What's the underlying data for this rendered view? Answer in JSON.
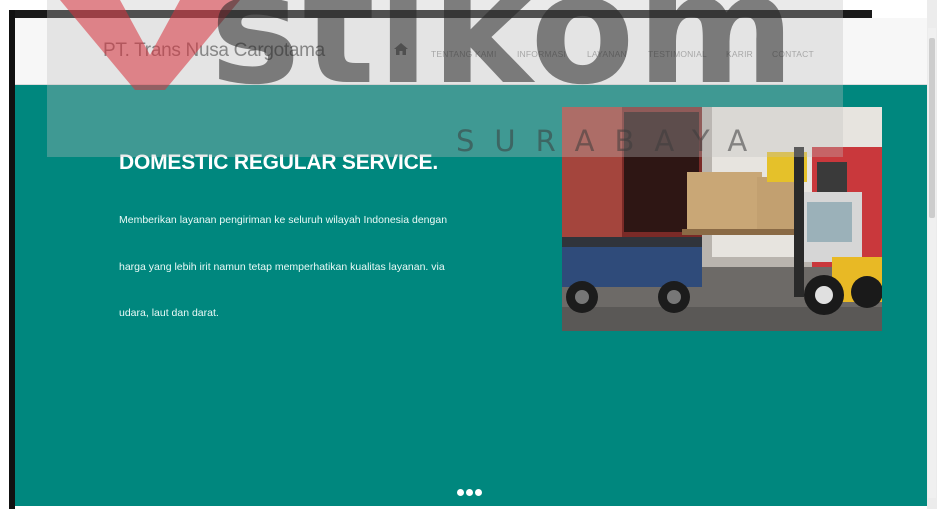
{
  "navbar": {
    "brand": "PT. Trans Nusa Cargotama",
    "home_icon": "home-icon",
    "items": [
      {
        "label": "TENTANG KAMI"
      },
      {
        "label": "INFORMASI"
      },
      {
        "label": "LAYANAN"
      },
      {
        "label": "TESTIMONIAL"
      },
      {
        "label": "KARIR"
      },
      {
        "label": "CONTACT"
      }
    ]
  },
  "hero": {
    "title": "DOMESTIC REGULAR SERVICE.",
    "lines": [
      "Memberikan layanan pengiriman ke seluruh wilayah Indonesia dengan",
      "harga yang lebih irit namun tetap memperhatikan kualitas layanan. via",
      "udara, laut dan darat."
    ],
    "image": "cargo-forklift-photo",
    "slides": 3
  },
  "watermark": {
    "word": "stikom",
    "sub": "SURABAYA"
  },
  "colors": {
    "hero_bg": "#00877e",
    "navbar_bg": "#f7f7f7",
    "nav_text": "#9a9a9a"
  }
}
